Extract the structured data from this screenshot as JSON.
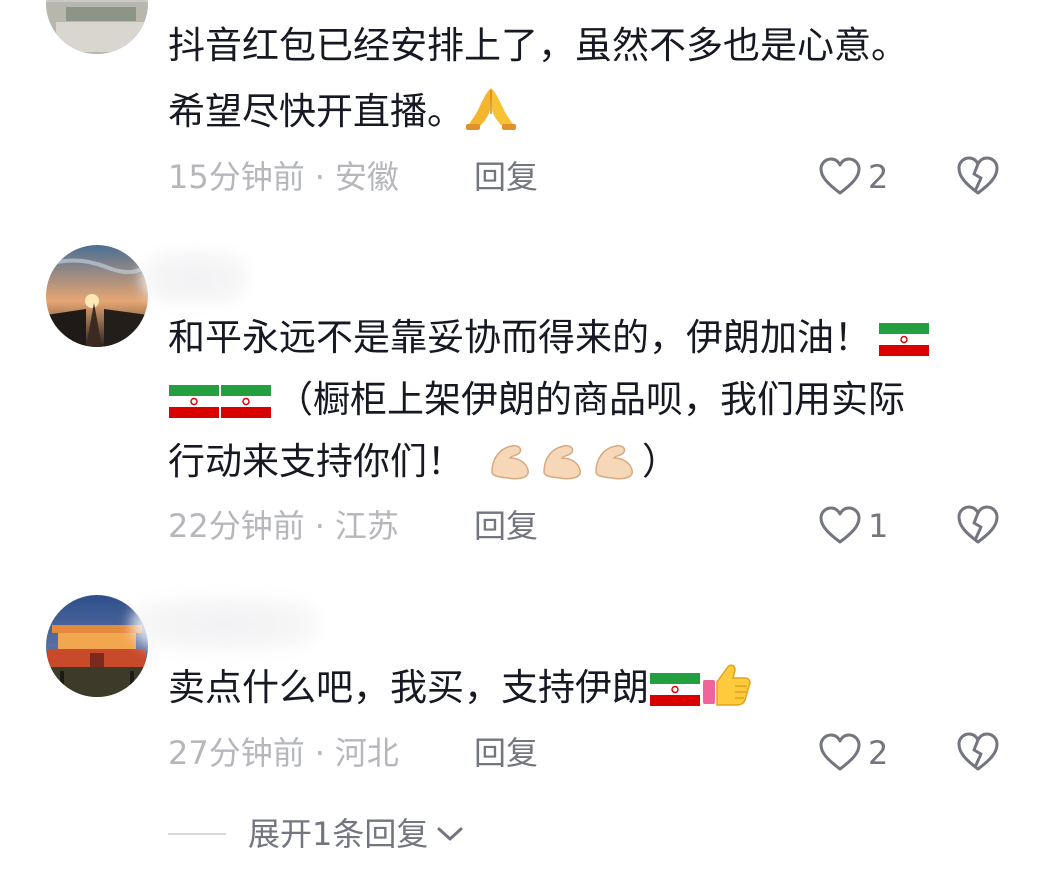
{
  "comments": [
    {
      "lines": [
        "抖音红包已经安排上了，虽然不多也是心意。",
        "希望尽快开直播。"
      ],
      "emoji": "folded-hands",
      "time": "15分钟前",
      "sep": "·",
      "location": "安徽",
      "reply_label": "回复",
      "like_count": "2"
    },
    {
      "lines": [
        "和平永远不是靠妥协而得来的，伊朗加油！",
        "（橱柜上架伊朗的商品呗，我们用实际",
        "行动来支持你们！",
        "）"
      ],
      "emoji": "flexed-biceps",
      "time": "22分钟前",
      "sep": "·",
      "location": "江苏",
      "reply_label": "回复",
      "like_count": "1"
    },
    {
      "lines": [
        "卖点什么吧，我买，支持伊朗"
      ],
      "emoji": "thumbs-up",
      "time": "27分钟前",
      "sep": "·",
      "location": "河北",
      "reply_label": "回复",
      "like_count": "2"
    }
  ],
  "expand_label": "展开1条回复",
  "colors": {
    "text": "#161823",
    "meta": "#b6b7bd",
    "action": "#737580",
    "flag_green": "#239f40",
    "flag_red": "#da0000"
  },
  "icons": {
    "like": "heart-outline-icon",
    "dislike": "broken-heart-icon",
    "expand": "chevron-down-icon"
  }
}
